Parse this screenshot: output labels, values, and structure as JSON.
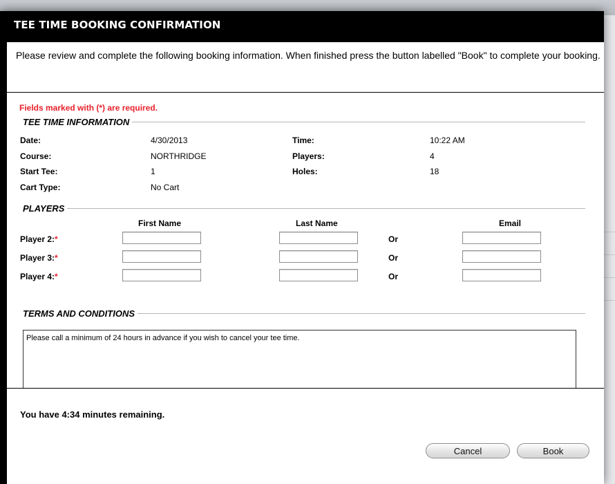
{
  "dialog": {
    "title": "TEE TIME BOOKING CONFIRMATION",
    "intro": "Please review and complete the following booking information. When finished press the button labelled \"Book\" to complete your booking."
  },
  "form": {
    "required_note": "Fields marked with (*) are required.",
    "tee_time_section": "TEE TIME INFORMATION",
    "tee_time": {
      "date_label": "Date:",
      "date_value": "4/30/2013",
      "time_label": "Time:",
      "time_value": "10:22 AM",
      "course_label": "Course:",
      "course_value": "NORTHRIDGE",
      "players_label": "Players:",
      "players_value": "4",
      "start_tee_label": "Start Tee:",
      "start_tee_value": "1",
      "holes_label": "Holes:",
      "holes_value": "18",
      "cart_type_label": "Cart Type:",
      "cart_type_value": "No Cart"
    },
    "players_section": "PLAYERS",
    "columns": {
      "first_name": "First Name",
      "last_name": "Last Name",
      "email": "Email"
    },
    "required_marker": "*",
    "players": [
      {
        "label": "Player 2:",
        "or": "Or",
        "first_name": "",
        "last_name": "",
        "email": ""
      },
      {
        "label": "Player 3:",
        "or": "Or",
        "first_name": "",
        "last_name": "",
        "email": ""
      },
      {
        "label": "Player 4:",
        "or": "Or",
        "first_name": "",
        "last_name": "",
        "email": ""
      }
    ],
    "terms_section": "TERMS AND CONDITIONS",
    "terms_text": "Please call a minimum of 24 hours in advance if you wish to cancel your tee time."
  },
  "footer": {
    "timer_text": "You have 4:34 minutes remaining.",
    "cancel_label": "Cancel",
    "book_label": "Book"
  }
}
